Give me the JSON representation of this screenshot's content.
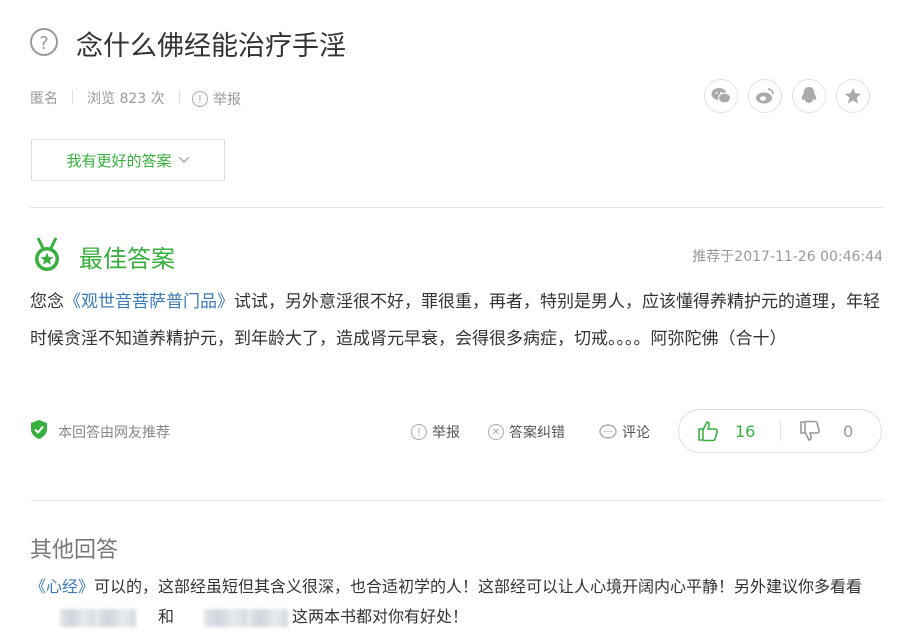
{
  "question": {
    "title": "念什么佛经能治疗手淫",
    "author": "匿名",
    "views": "浏览 823 次",
    "report": "举报",
    "better_answer_button": "我有更好的答案"
  },
  "share": {
    "icons": [
      "wechat-icon",
      "weibo-icon",
      "qq-icon",
      "favorite-star-icon"
    ]
  },
  "best_answer": {
    "heading": "最佳答案",
    "time": "推荐于2017-11-26 00:46:44",
    "text_pre": "您念",
    "book": "《观世音菩萨普门品》",
    "text_post": "试试，另外意淫很不好，罪很重，再者，特别是男人，应该懂得养精护元的道理，年轻时候贪淫不知道养精护元，到年龄大了，造成肾元早衰，会得很多病症，切戒。。。。阿弥陀佛（合十）",
    "recommend_note": "本回答由网友推荐",
    "actions": {
      "report": "举报",
      "correct": "答案纠错",
      "comment": "评论"
    },
    "votes": {
      "up": "16",
      "down": "0"
    }
  },
  "other_answers": {
    "heading": "其他回答",
    "book": "《心经》",
    "text_1": "可以的，这部经虽短但其含义很深，也合适初学的人！这部经可以让人心境开阔内心平静！另外建议你多看看",
    "text_and": "和",
    "text_2": "这两本书都对你有好处！"
  },
  "colors": {
    "accent_green": "#38b03f",
    "link_blue": "#3c79b8",
    "muted_gray": "#999999"
  }
}
